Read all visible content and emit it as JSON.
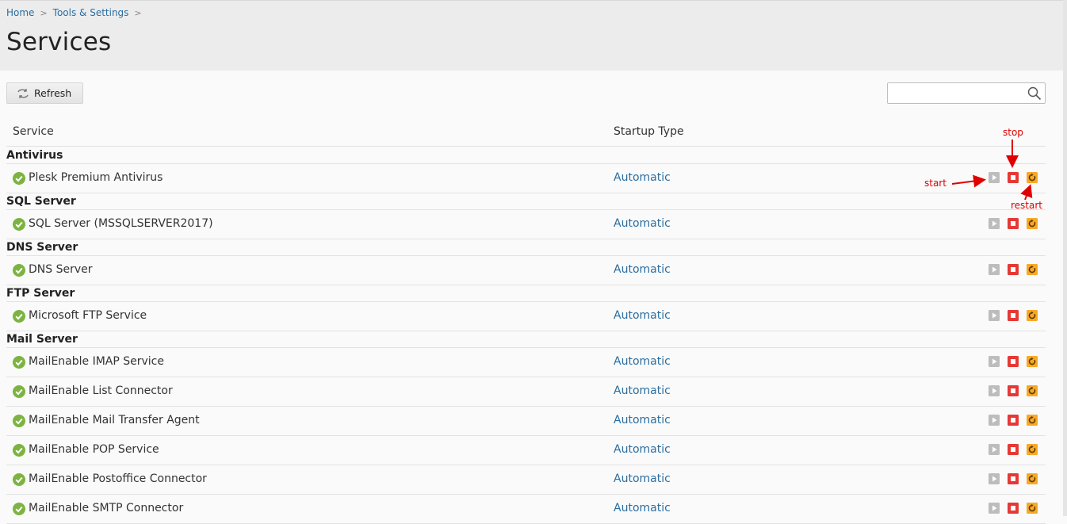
{
  "breadcrumb": {
    "home": "Home",
    "tools": "Tools & Settings",
    "sep": ">"
  },
  "page": {
    "title": "Services"
  },
  "toolbar": {
    "refresh_label": "Refresh"
  },
  "search": {
    "placeholder": ""
  },
  "table": {
    "col_service": "Service",
    "col_startup": "Startup Type"
  },
  "groups": [
    {
      "label": "Antivirus",
      "services": [
        {
          "name": "Plesk Premium Antivirus",
          "startup": "Automatic"
        }
      ]
    },
    {
      "label": "SQL Server",
      "services": [
        {
          "name": "SQL Server (MSSQLSERVER2017)",
          "startup": "Automatic"
        }
      ]
    },
    {
      "label": "DNS Server",
      "services": [
        {
          "name": "DNS Server",
          "startup": "Automatic"
        }
      ]
    },
    {
      "label": "FTP Server",
      "services": [
        {
          "name": "Microsoft FTP Service",
          "startup": "Automatic"
        }
      ]
    },
    {
      "label": "Mail Server",
      "services": [
        {
          "name": "MailEnable IMAP Service",
          "startup": "Automatic"
        },
        {
          "name": "MailEnable List Connector",
          "startup": "Automatic"
        },
        {
          "name": "MailEnable Mail Transfer Agent",
          "startup": "Automatic"
        },
        {
          "name": "MailEnable POP Service",
          "startup": "Automatic"
        },
        {
          "name": "MailEnable Postoffice Connector",
          "startup": "Automatic"
        },
        {
          "name": "MailEnable SMTP Connector",
          "startup": "Automatic"
        }
      ]
    }
  ],
  "annotations": {
    "stop": "stop",
    "start": "start",
    "restart": "restart"
  },
  "colors": {
    "link": "#2b6ea0",
    "ok": "#7cb342",
    "stop": "#e53935",
    "restart": "#f9a825",
    "start": "#bdbdbd",
    "annotation": "#e00000"
  }
}
